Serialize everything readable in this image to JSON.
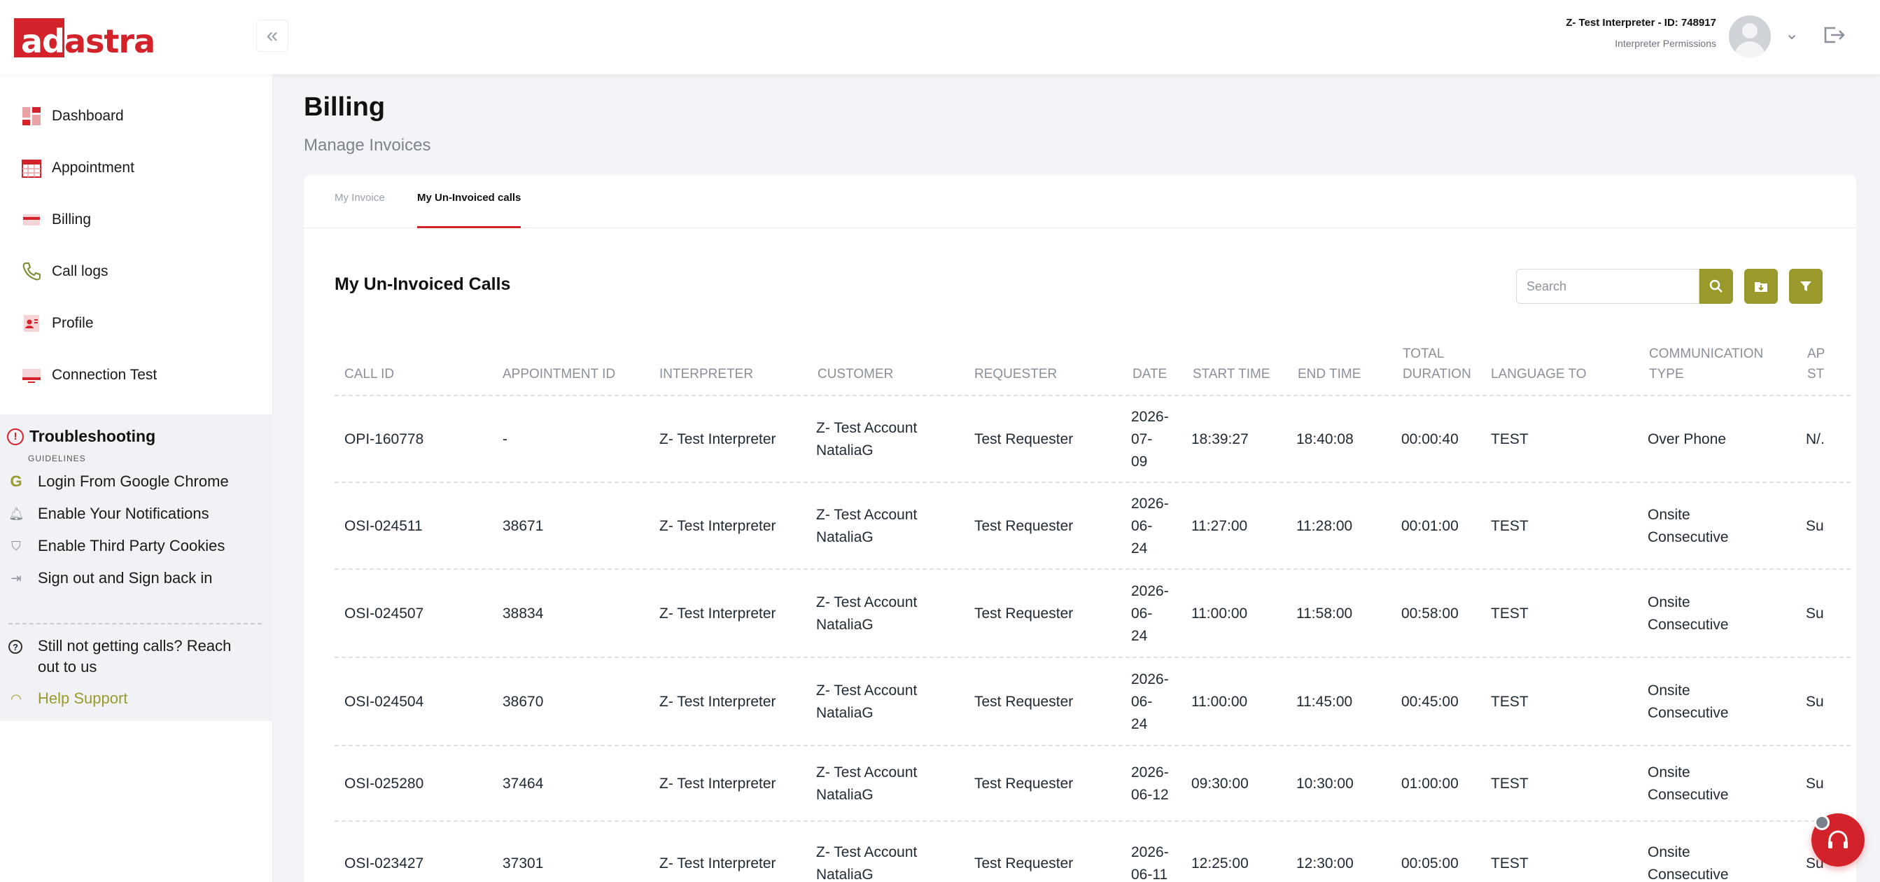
{
  "header": {
    "logo_text_a": "ad",
    "logo_text_b": "astra",
    "user_name": "Z- Test Interpreter - ID: 748917",
    "user_role": "Interpreter Permissions"
  },
  "sidebar": {
    "items": [
      {
        "label": "Dashboard",
        "icon": "dashboard-icon"
      },
      {
        "label": "Appointment",
        "icon": "calendar-icon"
      },
      {
        "label": "Billing",
        "icon": "billing-icon"
      },
      {
        "label": "Call logs",
        "icon": "phone-icon"
      },
      {
        "label": "Profile",
        "icon": "profile-icon"
      },
      {
        "label": "Connection Test",
        "icon": "monitor-icon"
      }
    ],
    "troubleshooting": {
      "title": "Troubleshooting",
      "subtitle": "GUIDELINES",
      "items": [
        {
          "label": "Login From Google Chrome",
          "icon": "google-icon"
        },
        {
          "label": "Enable Your Notifications",
          "icon": "bell-icon"
        },
        {
          "label": "Enable Third Party Cookies",
          "icon": "shield-icon"
        },
        {
          "label": "Sign out and Sign back in",
          "icon": "logout-icon"
        }
      ],
      "help_text": "Still not getting calls? Reach out to us",
      "support_label": "Help Support"
    }
  },
  "page": {
    "title": "Billing",
    "subtitle": "Manage Invoices",
    "tabs": [
      {
        "label": "My Invoice",
        "active": false
      },
      {
        "label": "My Un-Invoiced calls",
        "active": true
      }
    ],
    "section_title": "My Un-Invoiced Calls",
    "search_placeholder": "Search"
  },
  "table": {
    "columns": [
      "CALL ID",
      "APPOINTMENT ID",
      "INTERPRETER",
      "CUSTOMER",
      "REQUESTER",
      "DATE",
      "START TIME",
      "END TIME",
      [
        "TOTAL",
        "DURATION"
      ],
      "LANGUAGE TO",
      [
        "COMMUNICATION",
        "TYPE"
      ],
      [
        "AP",
        "ST"
      ]
    ],
    "rows": [
      {
        "call_id": "OPI-160778",
        "appointment_id": "-",
        "interpreter": "Z- Test Interpreter",
        "customer": [
          "Z- Test Account",
          "NataliaG"
        ],
        "requester": "Test Requester",
        "date": [
          "2026-",
          "07-",
          "09"
        ],
        "start": "18:39:27",
        "end": "18:40:08",
        "duration": "00:00:40",
        "language": "TEST",
        "comm": [
          "Over Phone"
        ],
        "status": "N/."
      },
      {
        "call_id": "OSI-024511",
        "appointment_id": "38671",
        "interpreter": "Z- Test Interpreter",
        "customer": [
          "Z- Test Account",
          "NataliaG"
        ],
        "requester": "Test Requester",
        "date": [
          "2026-",
          "06-",
          "24"
        ],
        "start": "11:27:00",
        "end": "11:28:00",
        "duration": "00:01:00",
        "language": "TEST",
        "comm": [
          "Onsite",
          "Consecutive"
        ],
        "status": "Su"
      },
      {
        "call_id": "OSI-024507",
        "appointment_id": "38834",
        "interpreter": "Z- Test Interpreter",
        "customer": [
          "Z- Test Account",
          "NataliaG"
        ],
        "requester": "Test Requester",
        "date": [
          "2026-",
          "06-",
          "24"
        ],
        "start": "11:00:00",
        "end": "11:58:00",
        "duration": "00:58:00",
        "language": "TEST",
        "comm": [
          "Onsite",
          "Consecutive"
        ],
        "status": "Su"
      },
      {
        "call_id": "OSI-024504",
        "appointment_id": "38670",
        "interpreter": "Z- Test Interpreter",
        "customer": [
          "Z- Test Account",
          "NataliaG"
        ],
        "requester": "Test Requester",
        "date": [
          "2026-",
          "06-",
          "24"
        ],
        "start": "11:00:00",
        "end": "11:45:00",
        "duration": "00:45:00",
        "language": "TEST",
        "comm": [
          "Onsite",
          "Consecutive"
        ],
        "status": "Su"
      },
      {
        "call_id": "OSI-025280",
        "appointment_id": "37464",
        "interpreter": "Z- Test Interpreter",
        "customer": [
          "Z- Test Account",
          "NataliaG"
        ],
        "requester": "Test Requester",
        "date": [
          "2026-",
          "06-12"
        ],
        "start": "09:30:00",
        "end": "10:30:00",
        "duration": "01:00:00",
        "language": "TEST",
        "comm": [
          "Onsite",
          "Consecutive"
        ],
        "status": "Su"
      },
      {
        "call_id": "OSI-023427",
        "appointment_id": "37301",
        "interpreter": "Z- Test Interpreter",
        "customer": [
          "Z- Test Account",
          "NataliaG"
        ],
        "requester": "Test Requester",
        "date": [
          "2026-",
          "06-11"
        ],
        "start": "12:25:00",
        "end": "12:30:00",
        "duration": "00:05:00",
        "language": "TEST",
        "comm": [
          "Onsite",
          "Consecutive"
        ],
        "status": "Su"
      }
    ]
  },
  "colors": {
    "brand_red": "#d3222a",
    "accent_olive": "#9a9a2c",
    "text_muted": "#8a9099"
  }
}
